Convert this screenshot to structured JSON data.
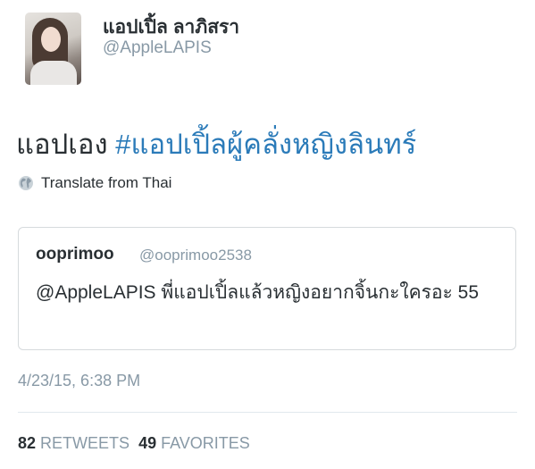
{
  "author": {
    "display_name": "แอปเปิ้ล ลาภิสรา",
    "handle": "@AppleLAPIS",
    "avatar_icon": "profile-photo"
  },
  "tweet": {
    "text_plain": "แอปเอง ",
    "hashtag": "#แอปเปิ้ลผู้คลั่งหญิงลินทร์",
    "hashtag_color": "#2b7bb9"
  },
  "translate": {
    "icon": "globe-icon",
    "label": "Translate from Thai"
  },
  "quoted_tweet": {
    "name": "ooprimoo",
    "handle": "@ooprimoo2538",
    "text": "@AppleLAPIS พี่แอปเปิ้ลแล้วหญิงอยากจิ้นกะใครอะ 55"
  },
  "timestamp": "4/23/15, 6:38 PM",
  "stats": {
    "retweets_count": "82",
    "retweets_label": "RETWEETS",
    "favorites_count": "49",
    "favorites_label": "FAVORITES"
  },
  "colors": {
    "text": "#292f33",
    "muted": "#8899a6",
    "link": "#2b7bb9",
    "border": "#d6dadd"
  }
}
